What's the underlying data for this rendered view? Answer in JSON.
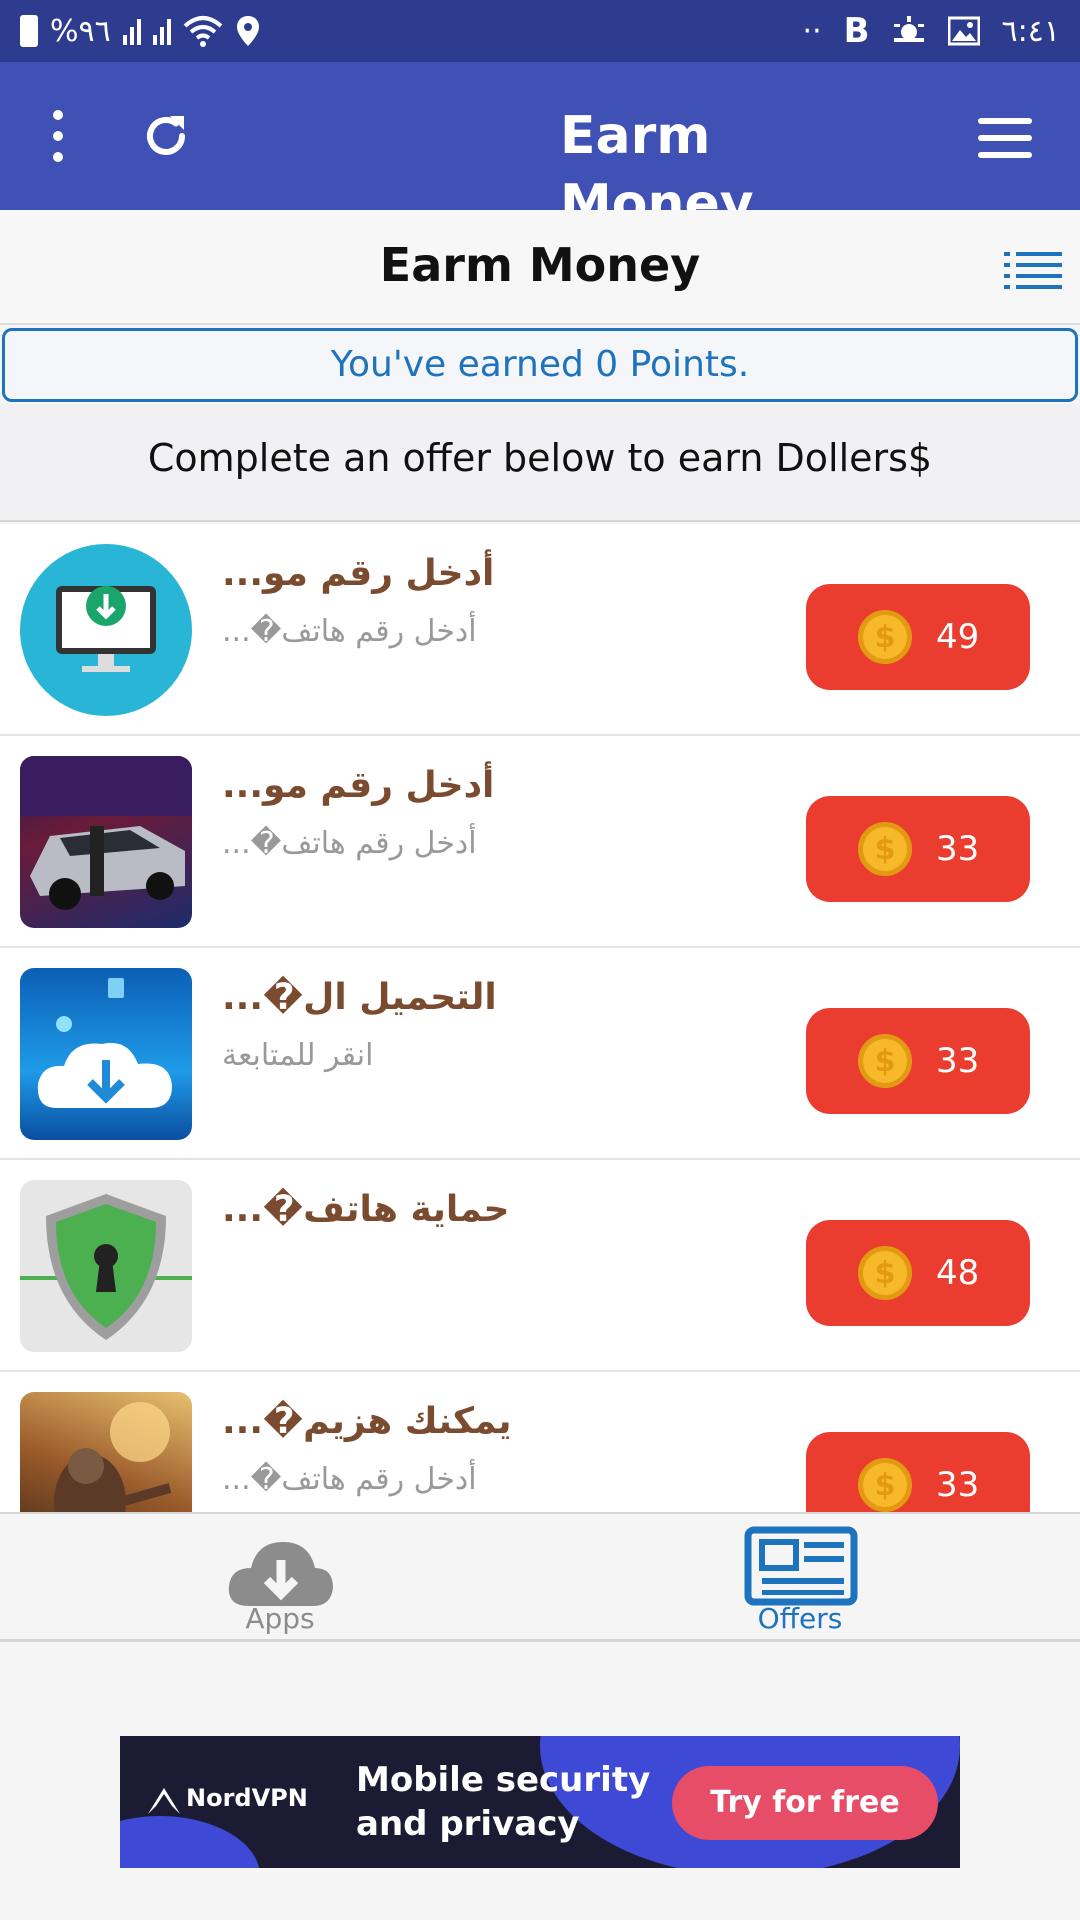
{
  "status_bar": {
    "battery": "%٩٦",
    "time": "٦:٤١",
    "dots": "··",
    "b_icon": "B"
  },
  "app_bar": {
    "title": "Earm Money",
    "icons": [
      "more-vertical-icon",
      "refresh-icon",
      "hamburger-menu-icon"
    ]
  },
  "page": {
    "subtitle": "Earm Money",
    "points_message": "You've earned 0 Points.",
    "instruction": "Complete an offer below to earn Dollers$"
  },
  "offers": [
    {
      "name": "...أدخل رقم مو",
      "description": "...�أدخل رقم هاتف",
      "points": "49",
      "thumb": "download-monitor-icon"
    },
    {
      "name": "...أدخل رقم مو",
      "description": "...�أدخل رقم هاتف",
      "points": "33",
      "thumb": "race-car-image"
    },
    {
      "name": "...�التحميل ال",
      "description": "انقر للمتابعة",
      "points": "33",
      "thumb": "cloud-download-icon"
    },
    {
      "name": "...�حماية هاتف",
      "description": "",
      "points": "48",
      "thumb": "shield-lock-icon"
    },
    {
      "name": "...�يمكنك هزيم",
      "description": "...�أدخل رقم هاتف",
      "points": "33",
      "thumb": "zombie-game-image"
    }
  ],
  "coin_symbol": "$",
  "bottom_nav": {
    "apps_label": "Apps",
    "offers_label": "Offers",
    "active": "offers"
  },
  "ad": {
    "brand": "NordVPN",
    "headline_line1": "Mobile security",
    "headline_line2": "and privacy",
    "cta": "Try for free"
  },
  "colors": {
    "status_bar": "#2e3c8f",
    "app_bar": "#3f51b5",
    "accent_blue": "#1e73be",
    "offer_button": "#ea3c2f",
    "coin": "#f7b82a",
    "offer_title": "#7a4b2f"
  }
}
